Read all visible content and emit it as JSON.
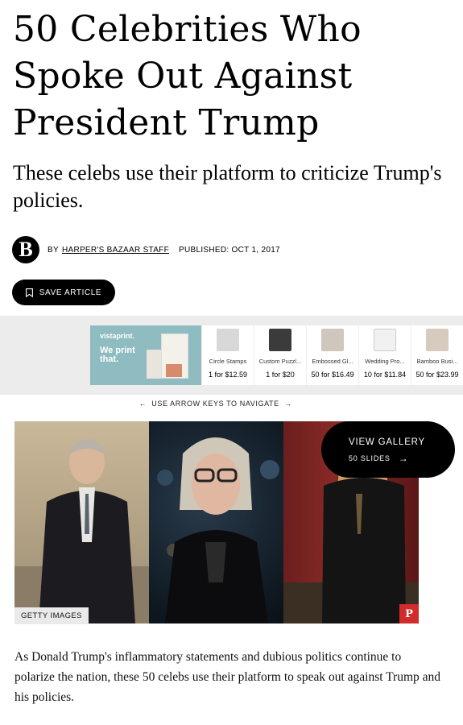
{
  "article": {
    "headline": "50 Celebrities Who Spoke Out Against President Trump",
    "dek": "These celebs use their platform to criticize Trump's policies.",
    "byline_prefix": "BY",
    "author": "HARPER'S BAZAAR STAFF",
    "published": "PUBLISHED: OCT 1, 2017",
    "logo_letter": "B",
    "save_label": "SAVE ARTICLE",
    "body": "As Donald Trump's inflammatory statements and dubious politics continue to polarize the nation, these 50 celebs use their platform to speak out against Trump and his policies."
  },
  "ad": {
    "brand": "vistaprint.",
    "tagline": "We print that.",
    "items": [
      {
        "name": "Circle Stamps",
        "price": "1 for $12.59"
      },
      {
        "name": "Custom Puzzl...",
        "price": "1 for $20"
      },
      {
        "name": "Embossed Gl...",
        "price": "50 for $16.49"
      },
      {
        "name": "Wedding Pro...",
        "price": "10 for $11.84"
      },
      {
        "name": "Bamboo Busi...",
        "price": "50 for $23.99"
      }
    ]
  },
  "gallery": {
    "nav_hint": "USE ARROW KEYS TO NAVIGATE",
    "view_label": "VIEW GALLERY",
    "slide_count": "50 SLIDES",
    "credit": "GETTY IMAGES",
    "pin_label": "P"
  }
}
